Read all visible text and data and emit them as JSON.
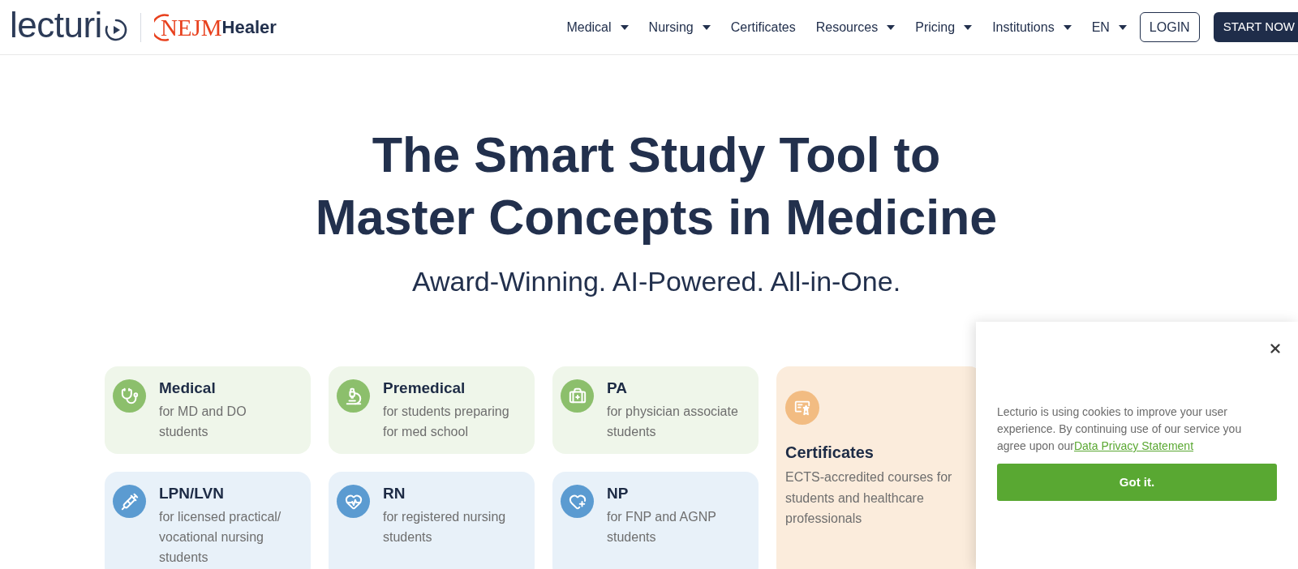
{
  "header": {
    "logo": {
      "wordmark": "lecturi",
      "partner_mark": "NEJM",
      "partner_name": "Healer"
    },
    "nav": [
      {
        "label": "Medical",
        "has_menu": true
      },
      {
        "label": "Nursing",
        "has_menu": true
      },
      {
        "label": "Certificates",
        "has_menu": false
      },
      {
        "label": "Resources",
        "has_menu": true
      },
      {
        "label": "Pricing",
        "has_menu": true
      },
      {
        "label": "Institutions",
        "has_menu": true
      },
      {
        "label": "EN",
        "has_menu": true
      }
    ],
    "login_button": "LOGIN",
    "start_button": "START NOW"
  },
  "hero": {
    "title": "The Smart Study Tool to Master Concepts in Medicine",
    "subtitle": "Award-Winning. AI-Powered. All-in-One."
  },
  "cards": [
    {
      "kind": "compact",
      "title": "Medical",
      "description": "for MD and DO students",
      "color": "#8cbf6c"
    },
    {
      "kind": "compact",
      "title": "Premedical",
      "description": "for students preparing for med school",
      "color": "#8cbf6c"
    },
    {
      "kind": "compact",
      "title": "PA",
      "description": "for physician associate students",
      "color": "#8cbf6c"
    },
    {
      "kind": "tall",
      "title": "Certificates",
      "description": "ECTS-accredited courses for students and healthcare professionals",
      "color": "#f2bc82"
    },
    {
      "kind": "compact",
      "title": "LPN/LVN",
      "description": "for licensed practical/ vocational nursing students",
      "color": "#5b9bd1"
    },
    {
      "kind": "compact",
      "title": "RN",
      "description": "for registered nursing students",
      "color": "#5b9bd1"
    },
    {
      "kind": "compact",
      "title": "NP",
      "description": "for FNP and AGNP students",
      "color": "#5b9bd1"
    }
  ],
  "cookie_banner": {
    "text": "Lecturio is using cookies to improve your user experience. By continuing use of our service you agree upon our",
    "link": "Data Privacy Statement",
    "button": "Got it."
  }
}
